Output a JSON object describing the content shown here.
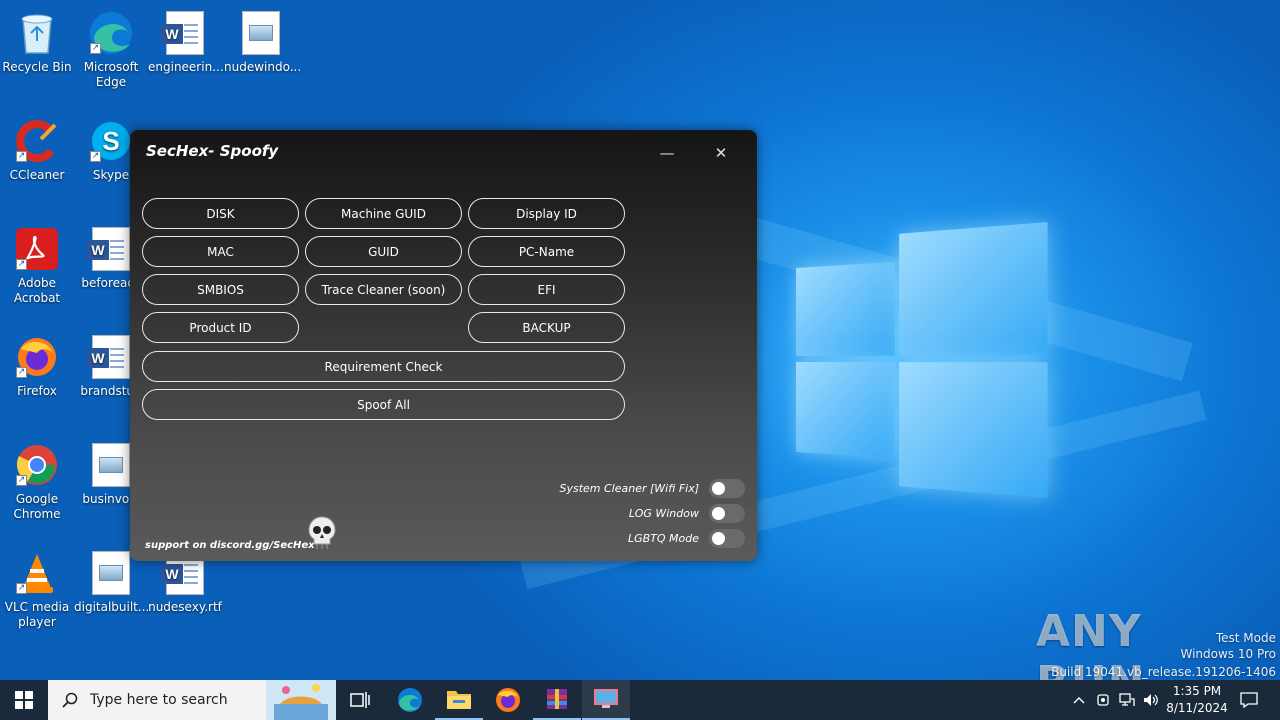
{
  "desktop": {
    "icons": [
      {
        "label": "Recycle Bin"
      },
      {
        "label": "Microsoft Edge"
      },
      {
        "label": "engineerin..."
      },
      {
        "label": "nudewindo..."
      },
      {
        "label": "CCleaner"
      },
      {
        "label": "Skype"
      },
      {
        "label": "Adobe Acrobat"
      },
      {
        "label": "beforeacc"
      },
      {
        "label": "Firefox"
      },
      {
        "label": "brandstud"
      },
      {
        "label": "Google Chrome"
      },
      {
        "label": "businvolv"
      },
      {
        "label": "VLC media player"
      },
      {
        "label": "digitalbuilt..."
      },
      {
        "label": "nudesexy.rtf"
      }
    ]
  },
  "app": {
    "title": "SecHex- Spoofy",
    "minimize_glyph": "—",
    "close_glyph": "✕",
    "buttons": {
      "disk": "DISK",
      "machine_guid": "Machine GUID",
      "display_id": "Display ID",
      "mac": "MAC",
      "guid": "GUID",
      "pc_name": "PC-Name",
      "smbios": "SMBIOS",
      "trace_cleaner": "Trace Cleaner (soon)",
      "efi": "EFI",
      "product_id": "Product ID",
      "backup": "BACKUP",
      "requirement_check": "Requirement Check",
      "spoof_all": "Spoof All"
    },
    "toggles": {
      "system_cleaner": {
        "label": "System Cleaner [Wifi Fix]",
        "on": false
      },
      "log_window": {
        "label": "LOG Window",
        "on": false
      },
      "lgbtq_mode": {
        "label": "LGBTQ Mode",
        "on": false
      }
    },
    "support_text": "support on discord.gg/SecHex"
  },
  "watermark": {
    "brand": "ANY RUN",
    "line1": "Test Mode",
    "line2": "Windows 10 Pro",
    "line3": "Build 19041.vb_release.191206-1406"
  },
  "taskbar": {
    "search_placeholder": "Type here to search",
    "time": "1:35 PM",
    "date": "8/11/2024"
  },
  "colors": {
    "desktop": "#0d74d3",
    "taskbar": "#1b2a3a",
    "window": "#2a2a2a"
  }
}
